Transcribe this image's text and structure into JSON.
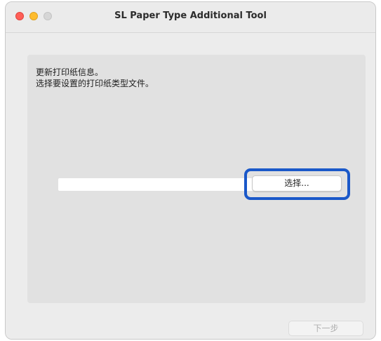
{
  "window": {
    "title": "SL Paper Type Additional Tool",
    "controls": [
      "close",
      "minimize",
      "zoom"
    ]
  },
  "main": {
    "instruction_line1": "更新打印纸信息。",
    "instruction_line2": "选择要设置的打印纸类型文件。",
    "file_path_value": "",
    "select_button_label": "选择...",
    "next_button_label": "下一步",
    "next_button_enabled": false
  },
  "colors": {
    "highlight": "#1a58c9",
    "close": "#ff5f57",
    "minimize": "#febc2e",
    "zoom_inactive": "#d6d6d6"
  }
}
